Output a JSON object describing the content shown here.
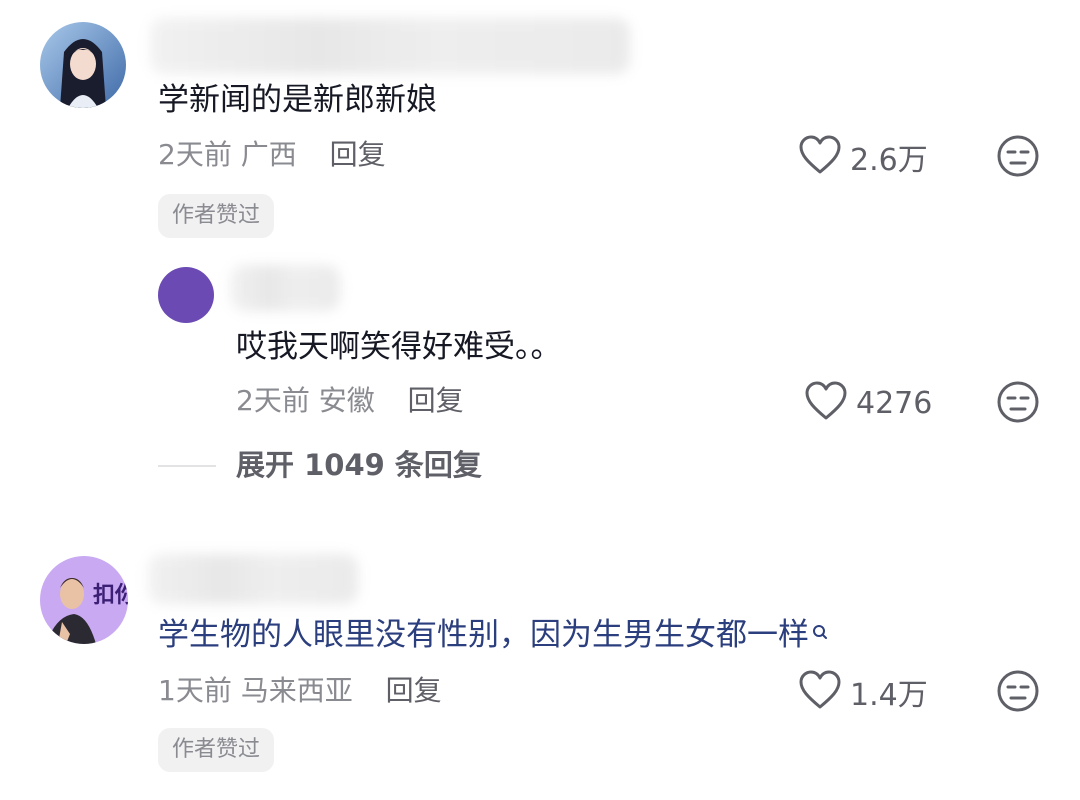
{
  "comments": [
    {
      "text": "学新闻的是新郎新娘",
      "time": "2天前",
      "location": "广西",
      "reply_label": "回复",
      "likes": "2.6万",
      "badge": "作者赞过",
      "reply": {
        "text": "哎我天啊笑得好难受。。",
        "time": "2天前",
        "location": "安徽",
        "reply_label": "回复",
        "likes": "4276"
      },
      "expand_label": "展开 1049 条回复"
    },
    {
      "avatar_text": "扣你",
      "text": "学生物的人眼里没有性别，因为生男生女都一样",
      "time": "1天前",
      "location": "马来西亚",
      "reply_label": "回复",
      "likes": "1.4万",
      "badge": "作者赞过"
    }
  ],
  "icons": {
    "like": "heart-outline-icon",
    "dislike": "expressionless-face-icon",
    "search": "search-icon"
  },
  "colors": {
    "text": "#161823",
    "meta": "#8a8b91",
    "link": "#2b3e7d",
    "reply_avatar": "#6b4bb3"
  }
}
